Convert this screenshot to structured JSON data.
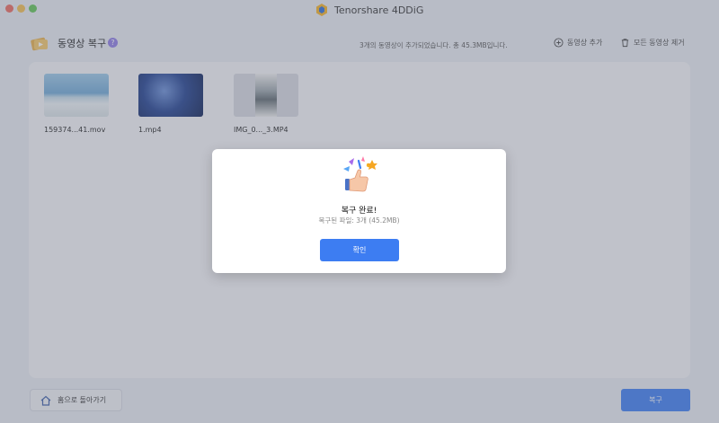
{
  "window": {
    "title": "Tenorshare 4DDiG"
  },
  "header": {
    "section_title": "동영상 복구",
    "help_glyph": "?",
    "status_text": "3개의 동영상이 추가되었습니다. 총 45.3MB입니다.",
    "add_label": "동영상 추가",
    "remove_all_label": "모든 동영상 제거"
  },
  "files": [
    {
      "name": "159374...41.mov",
      "thumb": "sea"
    },
    {
      "name": "1.mp4",
      "thumb": "jellyfish"
    },
    {
      "name": "IMG_0..._3.MP4",
      "thumb": "phone-portrait"
    }
  ],
  "dialog": {
    "title": "복구 완료!",
    "subtitle": "복구된 파일: 3개 (45.2MB)",
    "confirm_label": "확인"
  },
  "footer": {
    "home_label": "홈으로 돌아가기",
    "recover_label": "복구"
  },
  "colors": {
    "accent": "#3d7df2",
    "badge": "#8e7ce6"
  }
}
